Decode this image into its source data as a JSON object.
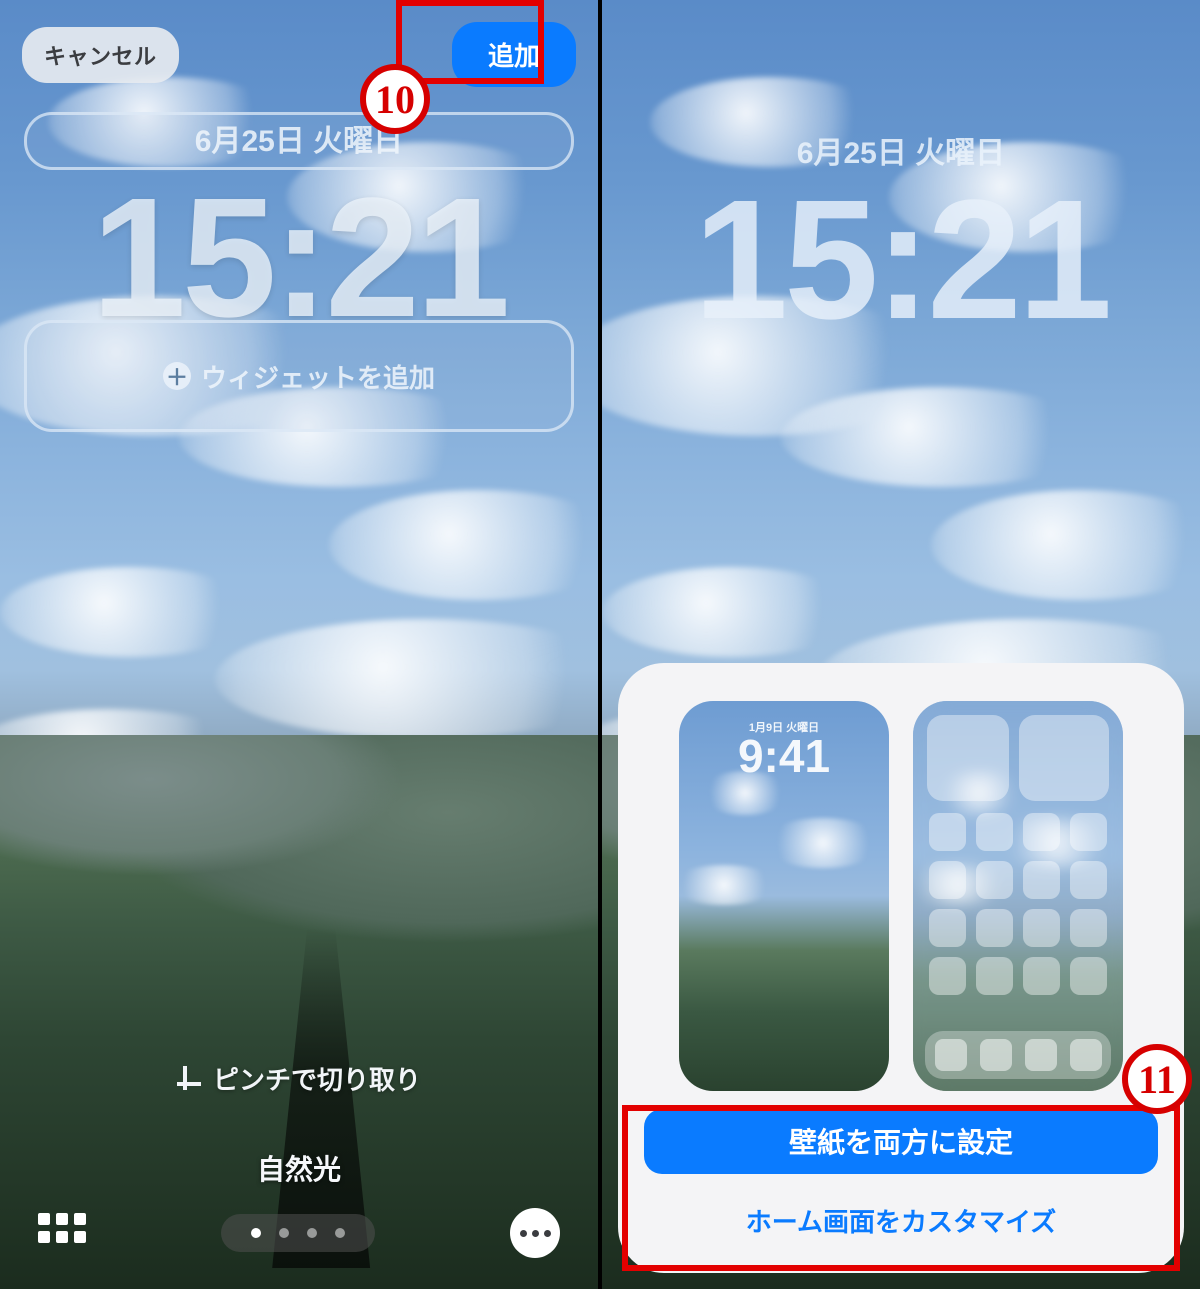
{
  "left": {
    "cancel_label": "キャンセル",
    "add_label": "追加",
    "date": "6月25日 火曜日",
    "time": "15:21",
    "add_widget_label": "ウィジェットを追加",
    "crop_label": "ピンチで切り取り",
    "filter_label": "自然光",
    "annotation_number": "10"
  },
  "right": {
    "date": "6月25日 火曜日",
    "time": "15:21",
    "preview_date": "1月9日 火曜日",
    "preview_time": "9:41",
    "set_both_label": "壁紙を両方に設定",
    "customize_home_label": "ホーム画面をカスタマイズ",
    "annotation_number": "11"
  }
}
